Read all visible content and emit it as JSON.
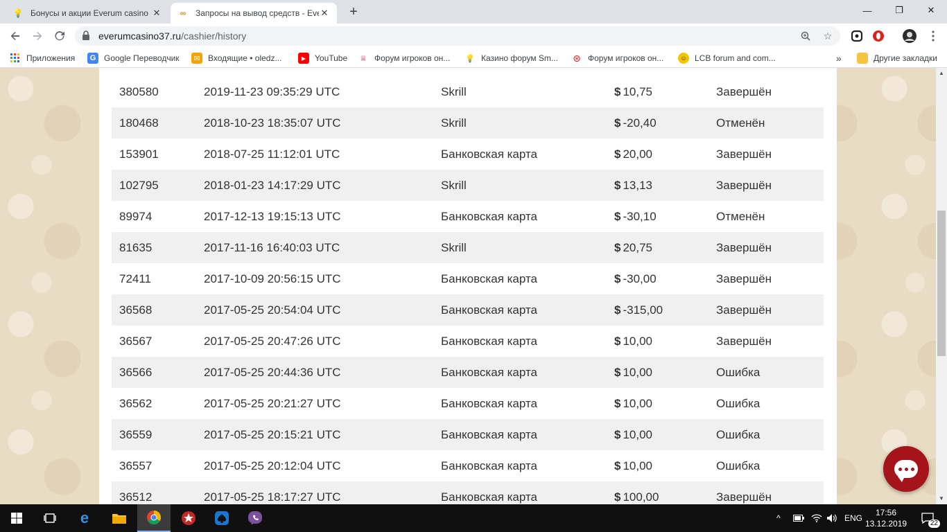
{
  "browser": {
    "tabs": [
      {
        "title": "Бонусы и акции Everum casino |",
        "favicon": "lightbulb-icon"
      },
      {
        "title": "Запросы на вывод средств - Eve",
        "favicon": "infinity-icon"
      }
    ],
    "new_tab": "+",
    "window_controls": {
      "minimize": "—",
      "maximize": "❐",
      "close": "✕"
    },
    "url_host": "everumcasino37.ru",
    "url_path": "/cashier/history",
    "bookmarks": [
      {
        "label": "Приложения",
        "icon": "apps-grid-icon"
      },
      {
        "label": "Google Переводчик",
        "icon": "google-translate-icon"
      },
      {
        "label": "Входящие • oledz...",
        "icon": "mail-inbox-icon"
      },
      {
        "label": "YouTube",
        "icon": "youtube-icon"
      },
      {
        "label": "Форум игроков он...",
        "icon": "forum-icon"
      },
      {
        "label": "Казино форум Sm...",
        "icon": "casino-forum-icon"
      },
      {
        "label": "Форум игроков он...",
        "icon": "poker-chip-icon"
      },
      {
        "label": "LCB forum and com...",
        "icon": "lcb-icon"
      }
    ],
    "bookmarks_overflow": "»",
    "other_bookmarks": "Другие закладки"
  },
  "withdrawals": [
    {
      "id": "380580",
      "date": "2019-11-23 09:35:29 UTC",
      "method": "Skrill",
      "currency": "$",
      "amount": "10,75",
      "status": "Завершён"
    },
    {
      "id": "180468",
      "date": "2018-10-23 18:35:07 UTC",
      "method": "Skrill",
      "currency": "$",
      "amount": "-20,40",
      "status": "Отменён"
    },
    {
      "id": "153901",
      "date": "2018-07-25 11:12:01 UTC",
      "method": "Банковская карта",
      "currency": "$",
      "amount": "20,00",
      "status": "Завершён"
    },
    {
      "id": "102795",
      "date": "2018-01-23 14:17:29 UTC",
      "method": "Skrill",
      "currency": "$",
      "amount": "13,13",
      "status": "Завершён"
    },
    {
      "id": "89974",
      "date": "2017-12-13 19:15:13 UTC",
      "method": "Банковская карта",
      "currency": "$",
      "amount": "-30,10",
      "status": "Отменён"
    },
    {
      "id": "81635",
      "date": "2017-11-16 16:40:03 UTC",
      "method": "Skrill",
      "currency": "$",
      "amount": "20,75",
      "status": "Завершён"
    },
    {
      "id": "72411",
      "date": "2017-10-09 20:56:15 UTC",
      "method": "Банковская карта",
      "currency": "$",
      "amount": "-30,00",
      "status": "Завершён"
    },
    {
      "id": "36568",
      "date": "2017-05-25 20:54:04 UTC",
      "method": "Банковская карта",
      "currency": "$",
      "amount": "-315,00",
      "status": "Завершён"
    },
    {
      "id": "36567",
      "date": "2017-05-25 20:47:26 UTC",
      "method": "Банковская карта",
      "currency": "$",
      "amount": "10,00",
      "status": "Завершён"
    },
    {
      "id": "36566",
      "date": "2017-05-25 20:44:36 UTC",
      "method": "Банковская карта",
      "currency": "$",
      "amount": "10,00",
      "status": "Ошибка"
    },
    {
      "id": "36562",
      "date": "2017-05-25 20:21:27 UTC",
      "method": "Банковская карта",
      "currency": "$",
      "amount": "10,00",
      "status": "Ошибка"
    },
    {
      "id": "36559",
      "date": "2017-05-25 20:15:21 UTC",
      "method": "Банковская карта",
      "currency": "$",
      "amount": "10,00",
      "status": "Ошибка"
    },
    {
      "id": "36557",
      "date": "2017-05-25 20:12:04 UTC",
      "method": "Банковская карта",
      "currency": "$",
      "amount": "10,00",
      "status": "Ошибка"
    },
    {
      "id": "36512",
      "date": "2017-05-25 18:17:27 UTC",
      "method": "Банковская карта",
      "currency": "$",
      "amount": "100,00",
      "status": "Завершён"
    }
  ],
  "colors": {
    "chat_button": "#a5141b",
    "page_background": "#e9dcc4",
    "row_alt": "#f0f0f0"
  },
  "taskbar": {
    "apps": [
      "windows-start-icon",
      "task-view-icon",
      "edge-icon",
      "file-explorer-icon",
      "chrome-icon",
      "pokerstars-icon",
      "poker-app-icon",
      "viber-icon"
    ],
    "language": "ENG",
    "time": "17:56",
    "date": "13.12.2019",
    "notifications": "22"
  }
}
